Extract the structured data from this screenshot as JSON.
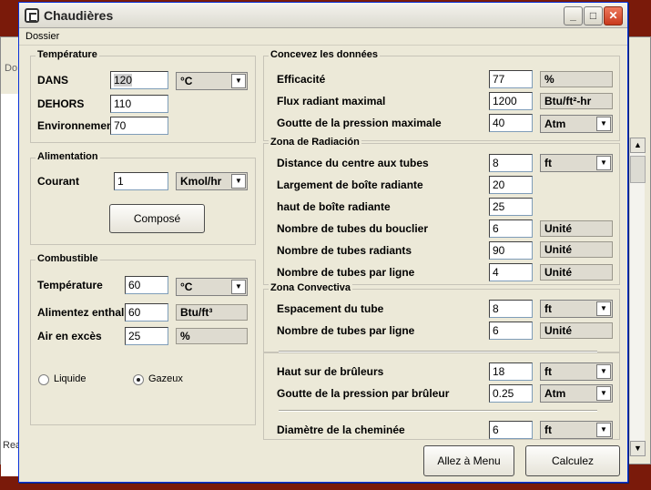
{
  "window": {
    "title": "Chaudières",
    "menu": [
      "Dossier"
    ]
  },
  "background": {
    "frag1": "Do",
    "frag2": "Rea"
  },
  "temperature": {
    "title": "Température",
    "dans_label": "DANS",
    "dans_value": "120",
    "dehors_label": "DEHORS",
    "dehors_value": "110",
    "env_label": "Environnemen",
    "env_value": "70",
    "unit": "°C"
  },
  "alimentation": {
    "title": "Alimentation",
    "courant_label": "Courant",
    "courant_value": "1",
    "unit": "Kmol/hr",
    "compose_button": "Composé"
  },
  "combustible": {
    "title": "Combustible",
    "temp_label": "Température",
    "temp_value": "60",
    "temp_unit": "°C",
    "enthalpy_label": "Alimentez enthalp",
    "enthalpy_value": "60",
    "enthalpy_unit": "Btu/ft³",
    "air_label": "Air en excès",
    "air_value": "25",
    "air_unit": "%",
    "liquide_label": "Liquide",
    "gazeux_label": "Gazeux",
    "selected": "gazeux"
  },
  "concevez": {
    "title": "Concevez les données",
    "efficacite_label": "Efficacité",
    "efficacite_value": "77",
    "efficacite_unit": "%",
    "flux_label": "Flux radiant maximal",
    "flux_value": "1200",
    "flux_unit": "Btu/ft²-hr",
    "goutte_label": "Goutte de la pression maximale",
    "goutte_value": "40",
    "goutte_unit": "Atm"
  },
  "radiacion": {
    "title": "Zona de Radiación",
    "distance_label": "Distance du centre aux tubes",
    "distance_value": "8",
    "distance_unit": "ft",
    "largement_label": "Largement de boîte radiante",
    "largement_value": "20",
    "haut_label": "haut de boîte radiante",
    "haut_value": "25",
    "bouclier_label": "Nombre de tubes du bouclier",
    "bouclier_value": "6",
    "bouclier_unit": "Unité",
    "radiants_label": "Nombre de tubes radiants",
    "radiants_value": "90",
    "radiants_unit": "Unité",
    "par_ligne_label": "Nombre de tubes par ligne",
    "par_ligne_value": "4",
    "par_ligne_unit": "Unité"
  },
  "convectiva": {
    "title": "Zona Convectiva",
    "espacement_label": "Espacement du tube",
    "espacement_value": "8",
    "espacement_unit": "ft",
    "par_ligne_label": "Nombre de tubes par ligne",
    "par_ligne_value": "6",
    "par_ligne_unit": "Unité"
  },
  "bruleurs": {
    "haut_label": "Haut sur de brûleurs",
    "haut_value": "18",
    "haut_unit": "ft",
    "goutte_label": "Goutte de la pression par brûleur",
    "goutte_value": "0.25",
    "goutte_unit": "Atm",
    "cheminee_label": "Diamètre de la cheminée",
    "cheminee_value": "6",
    "cheminee_unit": "ft"
  },
  "actions": {
    "allez_button": "Allez à Menu",
    "calculez_button": "Calculez"
  }
}
